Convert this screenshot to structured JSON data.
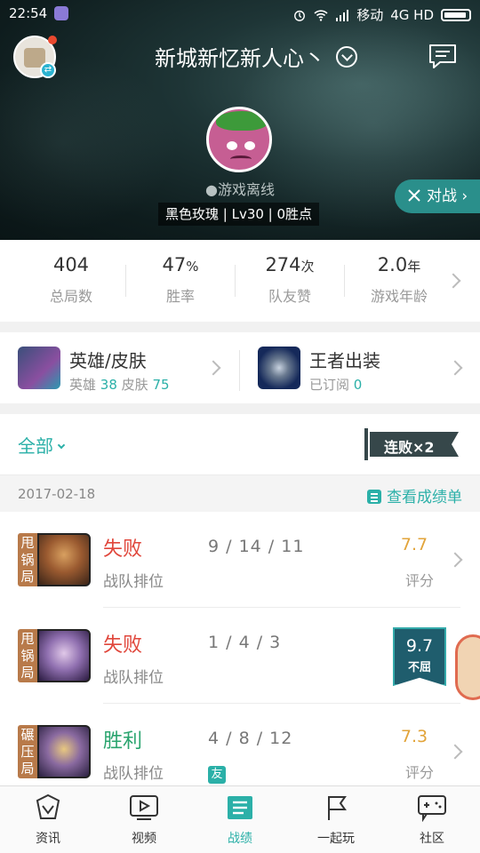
{
  "status_bar": {
    "time": "22:54",
    "carrier": "移动",
    "network": "4G HD"
  },
  "header": {
    "nickname": "新城新忆新人心丶",
    "online_status": "●游戏离线",
    "rank_line": "黑色玫瑰 | Lv30 | 0胜点",
    "battle_button": "对战",
    "colors": {
      "accent": "#2bb0a8",
      "battle_bg": "#2a8f8b"
    }
  },
  "stats": [
    {
      "value": "404",
      "unit": "",
      "label": "总局数"
    },
    {
      "value": "47",
      "unit": "%",
      "label": "胜率"
    },
    {
      "value": "274",
      "unit": "次",
      "label": "队友赞"
    },
    {
      "value": "2.0",
      "unit": "年",
      "label": "游戏年龄"
    }
  ],
  "hero_skin": {
    "title": "英雄/皮肤",
    "hero_label": "英雄",
    "hero_count": "38",
    "skin_label": "皮肤",
    "skin_count": "75"
  },
  "king_outfit": {
    "title": "王者出装",
    "sub_label": "已订阅",
    "sub_count": "0"
  },
  "filter": {
    "label": "全部"
  },
  "streak": {
    "label": "连败×2"
  },
  "date_bar": {
    "date": "2017-02-18",
    "report": "查看成绩单"
  },
  "matches": [
    {
      "mode": "甩锅局",
      "result": "失败",
      "type": "战队排位",
      "kda": "9 / 14 / 11",
      "score": "7.7",
      "score_label": "评分",
      "friend": ""
    },
    {
      "mode": "甩锅局",
      "result": "失败",
      "type": "战队排位",
      "kda": "1 / 4 / 3",
      "score": "9.7",
      "score_label": "不屈",
      "friend": ""
    },
    {
      "mode": "碾压局",
      "result": "胜利",
      "type": "战队排位",
      "kda": "4 / 8 / 12",
      "score": "7.3",
      "score_label": "评分",
      "friend": "友"
    }
  ],
  "bottom_nav": [
    {
      "label": "资讯",
      "icon": "news-icon"
    },
    {
      "label": "视频",
      "icon": "video-icon"
    },
    {
      "label": "战绩",
      "icon": "record-icon"
    },
    {
      "label": "一起玩",
      "icon": "flag-icon"
    },
    {
      "label": "社区",
      "icon": "community-icon"
    }
  ]
}
